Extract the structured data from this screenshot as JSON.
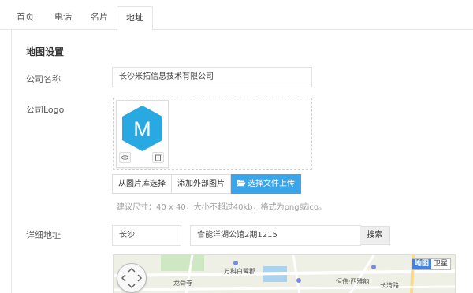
{
  "tabs": [
    "首页",
    "电话",
    "名片",
    "地址"
  ],
  "section_title": "地图设置",
  "company": {
    "label": "公司名称",
    "value": "长沙米拓信息技术有限公司"
  },
  "logo": {
    "label": "公司Logo",
    "letter": "M",
    "color": "#29a9e1",
    "buttons": [
      "从图片库选择",
      "添加外部图片",
      "选择文件上传"
    ],
    "hint": "建议尺寸：40 x 40，大小不超过40kb，格式为png或ico。"
  },
  "address": {
    "label": "详细地址",
    "city": "长沙",
    "detail": "合能洋湖公馆2期1215",
    "search_label": "搜索"
  },
  "map": {
    "type_map": "地图",
    "type_satellite": "卫星",
    "labels": [
      "万科白鹭郡",
      "龙骨寺",
      "恒伟·西雅韵",
      "长湾路"
    ]
  },
  "colors": {
    "primary": "#3aa5e8",
    "map_active": "#3e84e0"
  }
}
